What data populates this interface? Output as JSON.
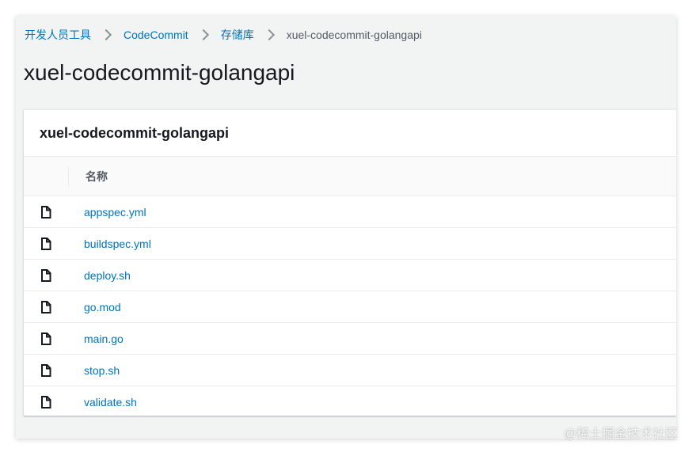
{
  "breadcrumb": {
    "items": [
      "开发人员工具",
      "CodeCommit",
      "存储库"
    ],
    "current": "xuel-codecommit-golangapi"
  },
  "page": {
    "title": "xuel-codecommit-golangapi"
  },
  "panel": {
    "title": "xuel-codecommit-golangapi",
    "column_name": "名称",
    "files": [
      {
        "name": "appspec.yml",
        "icon": "file-icon"
      },
      {
        "name": "buildspec.yml",
        "icon": "file-icon"
      },
      {
        "name": "deploy.sh",
        "icon": "file-icon"
      },
      {
        "name": "go.mod",
        "icon": "file-icon"
      },
      {
        "name": "main.go",
        "icon": "file-icon"
      },
      {
        "name": "stop.sh",
        "icon": "file-icon"
      },
      {
        "name": "validate.sh",
        "icon": "file-icon"
      }
    ]
  },
  "watermark": "@稀土掘金技术社区",
  "colors": {
    "link": "#0073bb",
    "text": "#16191f",
    "background": "#f2f3f3"
  }
}
